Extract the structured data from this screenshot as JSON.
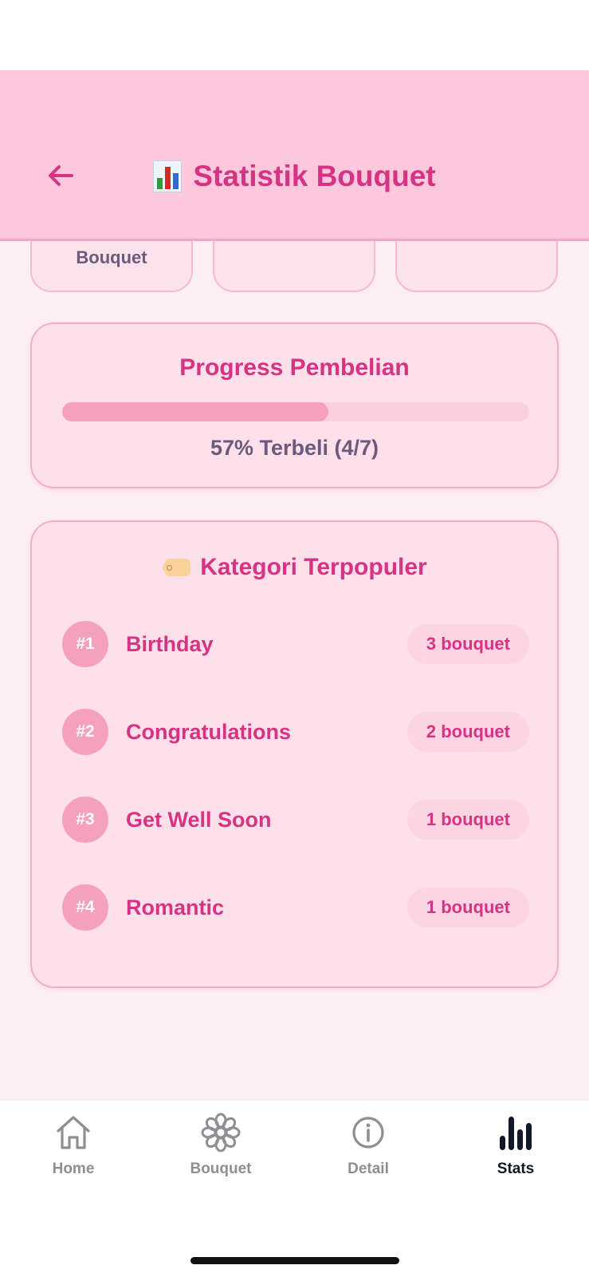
{
  "header": {
    "title": "Statistik Bouquet",
    "title_icon": "bar-chart-emoji",
    "accent_color": "#d63384"
  },
  "stat_cards": [
    {
      "label": "Bouquet"
    },
    {
      "label": ""
    },
    {
      "label": ""
    }
  ],
  "progress": {
    "title": "Progress Pembelian",
    "percent": 57,
    "text": "57% Terbeli (4/7)"
  },
  "categories": {
    "title": "Kategori Terpopuler",
    "title_icon": "tag-emoji",
    "items": [
      {
        "rank": "#1",
        "name": "Birthday",
        "count": "3 bouquet"
      },
      {
        "rank": "#2",
        "name": "Congratulations",
        "count": "2 bouquet"
      },
      {
        "rank": "#3",
        "name": "Get Well Soon",
        "count": "1 bouquet"
      },
      {
        "rank": "#4",
        "name": "Romantic",
        "count": "1 bouquet"
      }
    ]
  },
  "tabbar": {
    "tabs": [
      {
        "label": "Home",
        "icon": "home-icon",
        "active": false
      },
      {
        "label": "Bouquet",
        "icon": "flower-icon",
        "active": false
      },
      {
        "label": "Detail",
        "icon": "info-icon",
        "active": false
      },
      {
        "label": "Stats",
        "icon": "bar-chart-icon",
        "active": true
      }
    ]
  }
}
